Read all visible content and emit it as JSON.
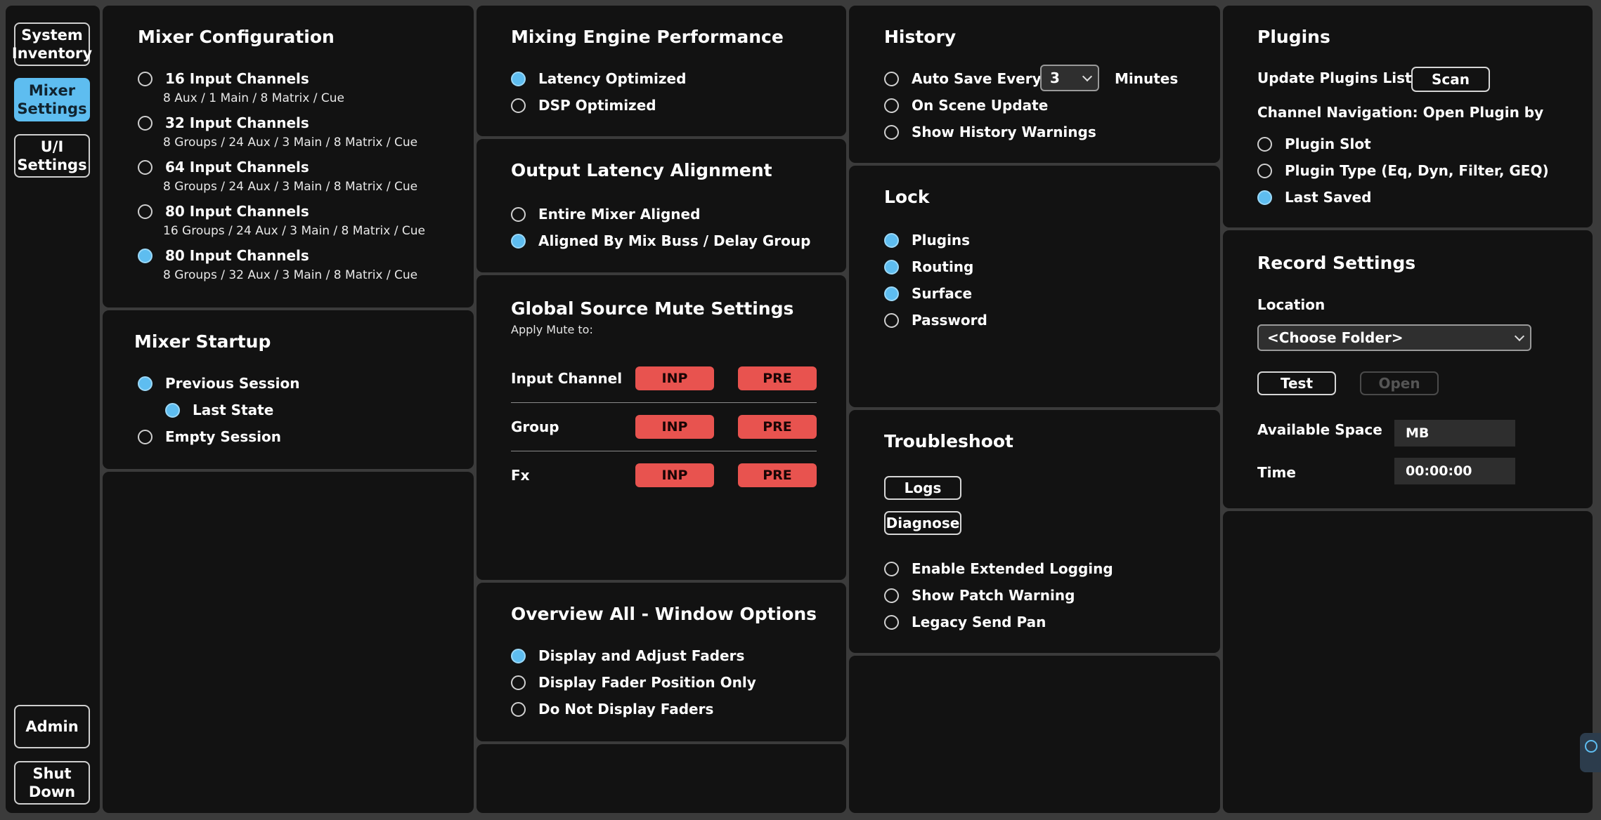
{
  "nav": {
    "system_inventory": "System\nInventory",
    "mixer_settings": "Mixer\nSettings",
    "ui_settings": "U/I\nSettings",
    "admin": "Admin",
    "shut_down": "Shut\nDown"
  },
  "mixer_config": {
    "title": "Mixer Configuration",
    "options": [
      {
        "label": "16 Input Channels",
        "sub": "8 Aux / 1 Main / 8 Matrix / Cue",
        "selected": false
      },
      {
        "label": "32 Input Channels",
        "sub": "8 Groups / 24 Aux  / 3 Main / 8 Matrix / Cue",
        "selected": false
      },
      {
        "label": "64 Input Channels",
        "sub": "8 Groups / 24 Aux / 3 Main / 8 Matrix / Cue",
        "selected": false
      },
      {
        "label": "80 Input Channels",
        "sub": "16 Groups / 24 Aux  / 3 Main / 8 Matrix / Cue",
        "selected": false
      },
      {
        "label": "80 Input Channels",
        "sub": "8 Groups / 32 Aux  / 3 Main / 8 Matrix / Cue",
        "selected": true
      }
    ]
  },
  "mixer_startup": {
    "title": "Mixer Startup",
    "previous_session": "Previous Session",
    "last_state": "Last State",
    "empty_session": "Empty Session"
  },
  "engine_perf": {
    "title": "Mixing Engine Performance",
    "latency_optimized": "Latency Optimized",
    "dsp_optimized": "DSP Optimized"
  },
  "output_latency": {
    "title": "Output Latency Alignment",
    "entire_mixer": "Entire Mixer Aligned",
    "by_mix_buss": "Aligned By Mix Buss / Delay Group"
  },
  "mute": {
    "title": "Global Source Mute Settings",
    "subtitle": "Apply Mute to:",
    "rows": [
      {
        "label": "Input Channel",
        "inp": "INP",
        "pre": "PRE"
      },
      {
        "label": "Group",
        "inp": "INP",
        "pre": "PRE"
      },
      {
        "label": "Fx",
        "inp": "INP",
        "pre": "PRE"
      }
    ]
  },
  "overview": {
    "title": "Overview All - Window Options",
    "display_adjust": "Display and Adjust Faders",
    "position_only": "Display Fader Position Only",
    "no_display": "Do Not Display Faders"
  },
  "history": {
    "title": "History",
    "auto_save": "Auto Save Every",
    "interval": "3",
    "minutes": "Minutes",
    "on_scene_update": "On Scene Update",
    "show_warnings": "Show History Warnings"
  },
  "lock": {
    "title": "Lock",
    "plugins": "Plugins",
    "routing": "Routing",
    "surface": "Surface",
    "password": "Password"
  },
  "troubleshoot": {
    "title": "Troubleshoot",
    "logs": "Logs",
    "diagnose": "Diagnose",
    "extended_logging": "Enable Extended Logging",
    "patch_warning": "Show Patch Warning",
    "legacy_send_pan": "Legacy Send Pan"
  },
  "plugins": {
    "title": "Plugins",
    "update_list": "Update Plugins List",
    "scan": "Scan",
    "nav_label": "Channel Navigation: Open Plugin by",
    "slot": "Plugin Slot",
    "type": "Plugin Type (Eq, Dyn, Filter, GEQ)",
    "last_saved": "Last Saved"
  },
  "record": {
    "title": "Record Settings",
    "location": "Location",
    "folder": "<Choose Folder>",
    "test": "Test",
    "open": "Open",
    "available_space": "Available Space",
    "space_value": "MB",
    "time": "Time",
    "time_value": "00:00:00"
  },
  "colors": {
    "accent": "#5ebdf0",
    "mute_red": "#e8534f",
    "panel": "#121212",
    "background": "#3b3b3b"
  }
}
